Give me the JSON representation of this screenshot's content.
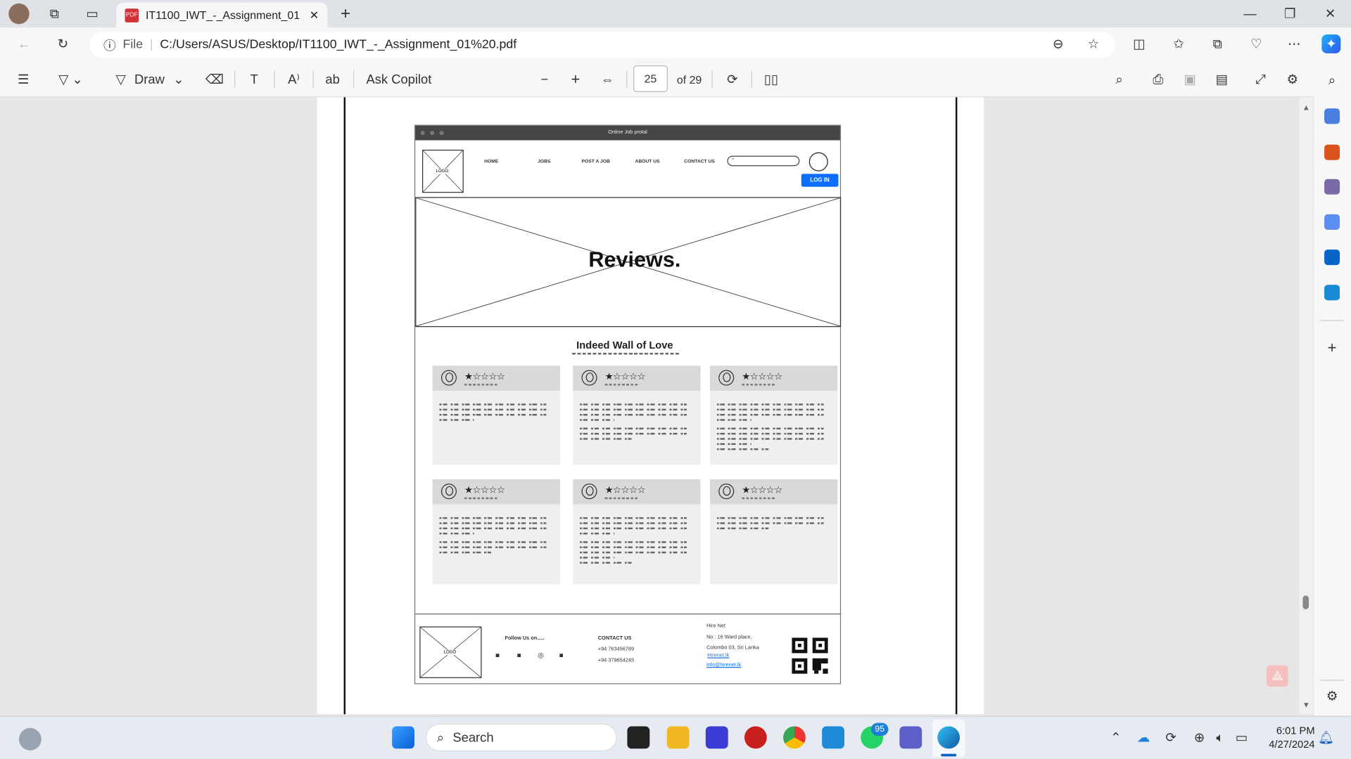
{
  "browser": {
    "tab_title": "IT1100_IWT_-_Assignment_01 .pdf",
    "url_prefix": "File",
    "url": "C:/Users/ASUS/Desktop/IT1100_IWT_-_Assignment_01%20.pdf"
  },
  "pdf_toolbar": {
    "draw_label": "Draw",
    "ask_copilot": "Ask Copilot",
    "page_current": "25",
    "page_total": "of 29"
  },
  "wireframe": {
    "window_title": "Online Job protal",
    "logo_label": "LOGO",
    "nav": [
      "HOME",
      "JOBS",
      "POST A JOB",
      "ABOUT US",
      "CONTACT US"
    ],
    "login_label": "LOG IN",
    "hero_title": "Reviews.",
    "section_title": "Indeed Wall of Love",
    "reviews": [
      {
        "rating": 1,
        "stars": "★☆☆☆☆"
      },
      {
        "rating": 1,
        "stars": "★☆☆☆☆"
      },
      {
        "rating": 1,
        "stars": "★☆☆☆☆"
      },
      {
        "rating": 1,
        "stars": "★☆☆☆☆"
      },
      {
        "rating": 1,
        "stars": "★☆☆☆☆"
      },
      {
        "rating": 1,
        "stars": "★☆☆☆☆"
      }
    ],
    "footer": {
      "logo_label": "LOGO",
      "follow": "Follow Us on.....",
      "social_icons": [
        "facebook-icon",
        "twitter-icon",
        "instagram-icon",
        "google-plus-icon"
      ],
      "contact_title": "CONTACT US",
      "phone1": "+94  763456789",
      "phone2": "+94 379654245",
      "company": "Hire Net",
      "address1": "No : 16 Ward place,",
      "address2": "Colombo 03, Sri Lanka",
      "website": "Hirenet.lk",
      "email": "info@hirenet.lk"
    }
  },
  "taskbar": {
    "search": "Search",
    "badge": "95",
    "time": "6:01 PM",
    "date": "4/27/2024"
  },
  "colors": {
    "accent": "#1a73e8",
    "login": "#0d6efd",
    "titlebar": "#454545"
  }
}
